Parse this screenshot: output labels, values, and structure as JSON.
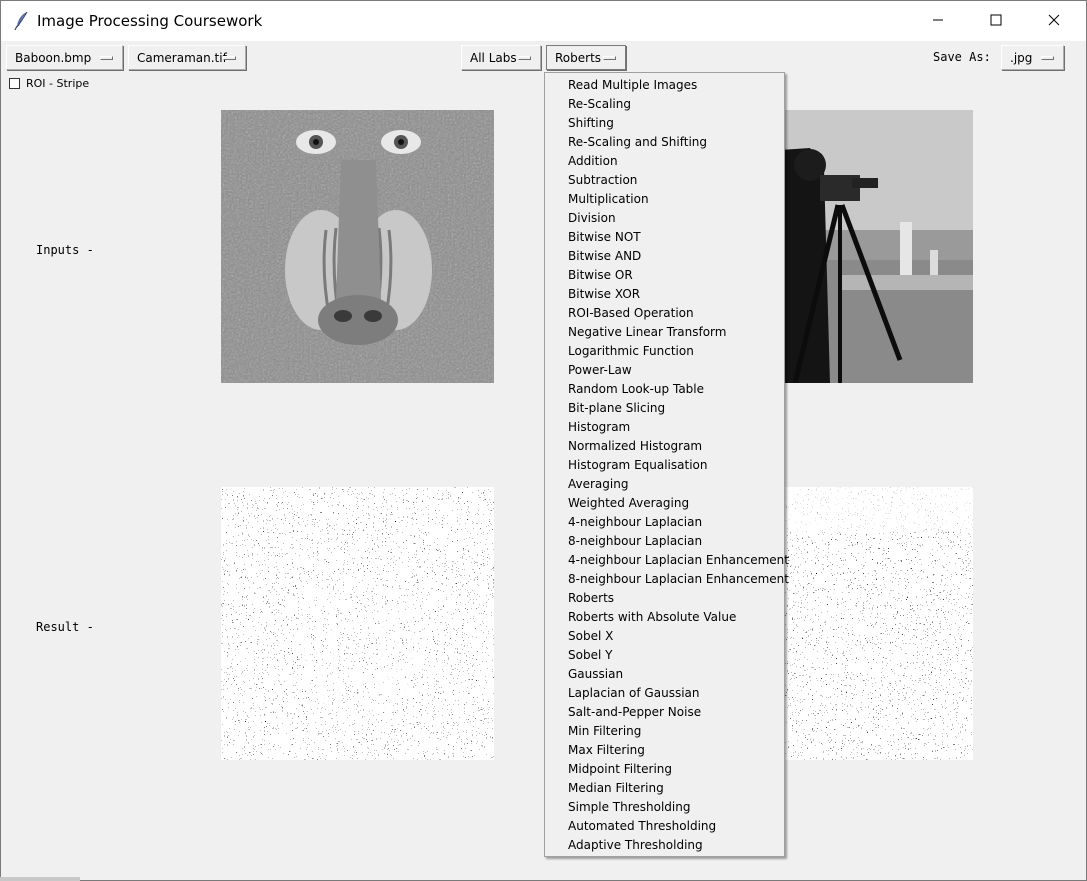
{
  "window": {
    "title": "Image Processing Coursework"
  },
  "toolbar": {
    "image1": "Baboon.bmp",
    "image2": "Cameraman.tif",
    "lab": "All Labs",
    "operation": "Roberts",
    "save_as_label": "Save As:",
    "format": ".jpg"
  },
  "roi": {
    "label": "ROI - Stripe",
    "checked": false
  },
  "rows": {
    "inputs_label": "Inputs -",
    "result_label": "Result -"
  },
  "menu": {
    "items": [
      "Read Multiple Images",
      "Re-Scaling",
      "Shifting",
      "Re-Scaling and Shifting",
      "Addition",
      "Subtraction",
      "Multiplication",
      "Division",
      "Bitwise NOT",
      "Bitwise AND",
      "Bitwise OR",
      "Bitwise XOR",
      "ROI-Based Operation",
      "Negative Linear Transform",
      "Logarithmic Function",
      "Power-Law",
      "Random Look-up Table",
      "Bit-plane Slicing",
      "Histogram",
      "Normalized Histogram",
      "Histogram Equalisation",
      "Averaging",
      "Weighted Averaging",
      "4-neighbour Laplacian",
      "8-neighbour Laplacian",
      "4-neighbour Laplacian Enhancement",
      "8-neighbour Laplacian Enhancement",
      "Roberts",
      "Roberts with Absolute Value",
      "Sobel X",
      "Sobel Y",
      "Gaussian",
      "Laplacian of Gaussian",
      "Salt-and-Pepper Noise",
      "Min Filtering",
      "Max Filtering",
      "Midpoint Filtering",
      "Median Filtering",
      "Simple Thresholding",
      "Automated Thresholding",
      "Adaptive Thresholding"
    ]
  },
  "icons": {
    "app": "feather-icon",
    "minimize": "minimize-icon",
    "maximize": "maximize-icon",
    "close": "close-icon"
  }
}
